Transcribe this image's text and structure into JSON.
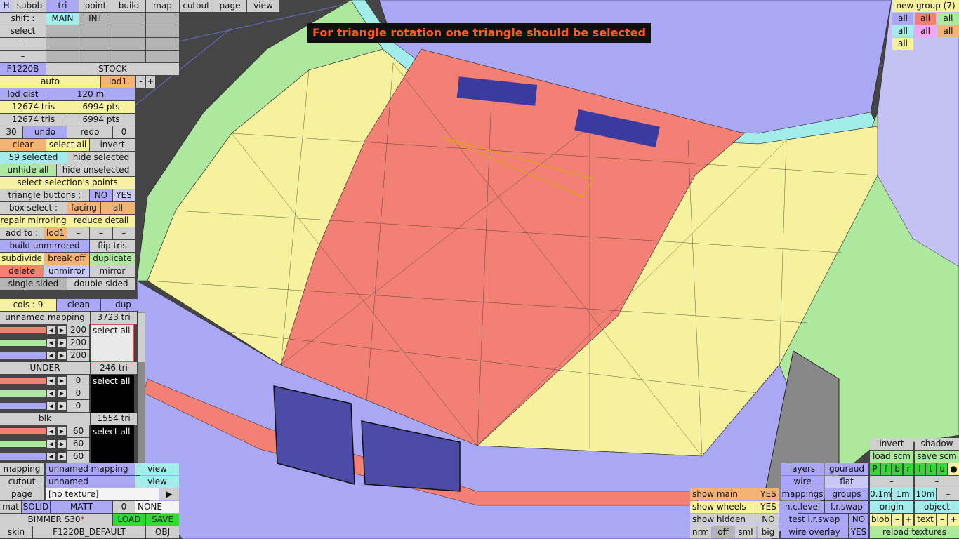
{
  "notice": "For triangle rotation one triangle should be selected",
  "top": {
    "h": "H",
    "subob": "subob",
    "tri": "tri",
    "point": "point",
    "build": "build",
    "map": "map",
    "cutout": "cutout",
    "page": "page",
    "view": "view"
  },
  "row_shift": {
    "label": "shift :",
    "main": "MAIN",
    "int": "INT"
  },
  "row_select": {
    "label": "select"
  },
  "dash": "–",
  "model": {
    "name": "F1220B",
    "variant": "STOCK"
  },
  "lod": {
    "auto": "auto",
    "current": "lod1",
    "minus": "-",
    "plus": "+",
    "dist_label": "lod dist",
    "dist_value": "120 m"
  },
  "stats": {
    "tris1": "12674 tris",
    "pts1": "6994 pts",
    "tris2": "12674 tris",
    "pts2": "6994 pts"
  },
  "undo": {
    "count": "30",
    "undo": "undo",
    "redo": "redo",
    "redo_count": "0"
  },
  "sel": {
    "clear": "clear",
    "select_all": "select all",
    "invert": "invert",
    "selected": "59 selected",
    "hide_selected": "hide selected",
    "unhide_all": "unhide all",
    "hide_unselected": "hide unselected",
    "select_points": "select selection's points"
  },
  "tri_buttons": {
    "label": "triangle buttons :",
    "no": "NO",
    "yes": "YES"
  },
  "box_select": {
    "label": "box select :",
    "facing": "facing",
    "all": "all"
  },
  "ops": {
    "repair_mirroring": "repair mirroring",
    "reduce_detail": "reduce detail",
    "add_to": "add to :",
    "add_lod": "lod1",
    "build_unmirrored": "build unmirrored",
    "flip_tris": "flip tris",
    "subdivide": "subdivide",
    "break_off": "break off",
    "duplicate": "duplicate",
    "delete": "delete",
    "unmirror": "unmirror",
    "mirror": "mirror",
    "single_sided": "single sided",
    "double_sided": "double sided"
  },
  "cols": {
    "label": "cols : 9",
    "clean": "clean",
    "dup": "dup"
  },
  "materials": [
    {
      "name": "unnamed mapping",
      "tris": "3723 tri",
      "v1": "200",
      "v2": "200",
      "v3": "200",
      "select_all": "select all"
    },
    {
      "name": "UNDER",
      "tris": "246 tri",
      "v1": "0",
      "v2": "0",
      "v3": "0",
      "select_all": "select all"
    },
    {
      "name": "blk",
      "tris": "1554 tri",
      "v1": "60",
      "v2": "60",
      "v3": "60",
      "select_all": "select all"
    }
  ],
  "bottom": {
    "mapping_label": "mapping",
    "mapping_value": "unnamed mapping",
    "view": "view",
    "cutout_label": "cutout",
    "cutout_value": "unnamed",
    "page_label": "page",
    "page_value": "[no texture]",
    "page_arrow": "▶",
    "mat": "mat",
    "solid": "SOLID",
    "matt": "MATT",
    "zero": "0",
    "none": "NONE",
    "project": "BIMMER S30",
    "modified_star": "*",
    "load": "LOAD",
    "save": "SAVE",
    "skin_label": "skin",
    "skin_value": "F1220B_DEFAULT",
    "obj": "OBJ"
  },
  "groups": {
    "new_group": "new group (7)",
    "all": "all"
  },
  "right": {
    "invert": "invert",
    "shadow": "shadow",
    "load_scm": "load scm",
    "save_scm": "save scm",
    "p": "P",
    "f": "f",
    "b": "b",
    "r": "r",
    "l": "l",
    "t": "t",
    "u": "u",
    "dot": "●",
    "layers": "layers",
    "gouraud": "gouraud",
    "wire": "wire",
    "flat": "flat",
    "mappings": "mappings",
    "groups": "groups",
    "m01": "0.1m",
    "m1": "1m",
    "m10": "10m",
    "minus": "–",
    "plus": "+",
    "nclevel": "n.c.level",
    "lrswap": "l.r.swap",
    "origin": "origin",
    "object": "object",
    "test_lr": "test l.r.swap",
    "no": "NO",
    "blob": "blob",
    "text": "text",
    "wire_overlay": "wire overlay",
    "yes": "YES",
    "reload": "reload textures"
  },
  "showbox": {
    "show_main": "show main",
    "yes1": "YES",
    "show_wheels": "show wheels",
    "yes2": "YES",
    "show_hidden": "show hidden",
    "no": "NO",
    "nrm": "nrm",
    "off": "off",
    "sml": "sml",
    "big": "big"
  },
  "colors": {
    "background": "#454545",
    "yellow": "#f6f19c",
    "salmon": "#f28074",
    "lavender": "#aaa8f4",
    "green": "#aee79e",
    "cyan": "#a3ecec",
    "orange": "#f4b273",
    "notice_text": "#ff5a1e"
  }
}
